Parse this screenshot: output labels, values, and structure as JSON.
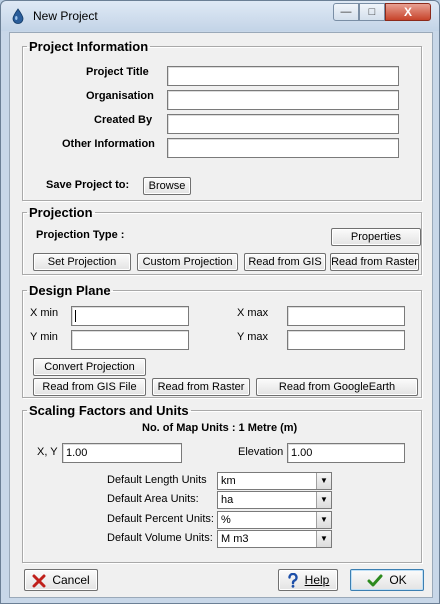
{
  "window": {
    "title": "New Project",
    "minimize_label": "—",
    "maximize_label": "□",
    "close_label": "X"
  },
  "project_information": {
    "title": "Project Information",
    "project_title_label": "Project Title",
    "project_title_value": "",
    "organisation_label": "Organisation",
    "organisation_value": "",
    "created_by_label": "Created By",
    "created_by_value": "",
    "other_information_label": "Other Information",
    "other_information_value": "",
    "save_project_label": "Save Project to:",
    "browse_label": "Browse"
  },
  "projection": {
    "title": "Projection",
    "type_label": "Projection Type :",
    "properties_label": "Properties",
    "set_projection_label": "Set Projection",
    "custom_projection_label": "Custom Projection",
    "read_from_gis_label": "Read from GIS",
    "read_from_raster_label": "Read from Raster"
  },
  "design_plane": {
    "title": "Design Plane",
    "xmin_label": "X min",
    "xmin_value": "",
    "xmax_label": "X max",
    "xmax_value": "",
    "ymin_label": "Y min",
    "ymin_value": "",
    "ymax_label": "Y max",
    "ymax_value": "",
    "convert_projection_label": "Convert Projection",
    "read_gis_file_label": "Read from GIS File",
    "read_raster_label": "Read from Raster",
    "read_googleearth_label": "Read from GoogleEarth"
  },
  "scaling": {
    "title": "Scaling Factors and Units",
    "map_units_text": "No. of Map Units : 1 Metre (m)",
    "xy_label": "X, Y",
    "xy_value": "1.00",
    "elevation_label": "Elevation",
    "elevation_value": "1.00",
    "length_units_label": "Default Length Units",
    "length_units_value": "km",
    "area_units_label": "Default Area Units:",
    "area_units_value": "ha",
    "percent_units_label": "Default Percent Units:",
    "percent_units_value": "%",
    "volume_units_label": "Default Volume Units:",
    "volume_units_value": "M m3"
  },
  "footer": {
    "cancel_label": "Cancel",
    "help_label": "Help",
    "ok_label": "OK"
  },
  "icons": {
    "app": "water-drop-icon",
    "cancel": "red-x-icon",
    "help": "question-mark-icon",
    "ok": "green-check-icon"
  },
  "colors": {
    "cancel_icon": "#c0201b",
    "help_icon": "#1d4fa8",
    "ok_icon": "#2c8a1e",
    "app_icon": "#2a5d9a"
  }
}
